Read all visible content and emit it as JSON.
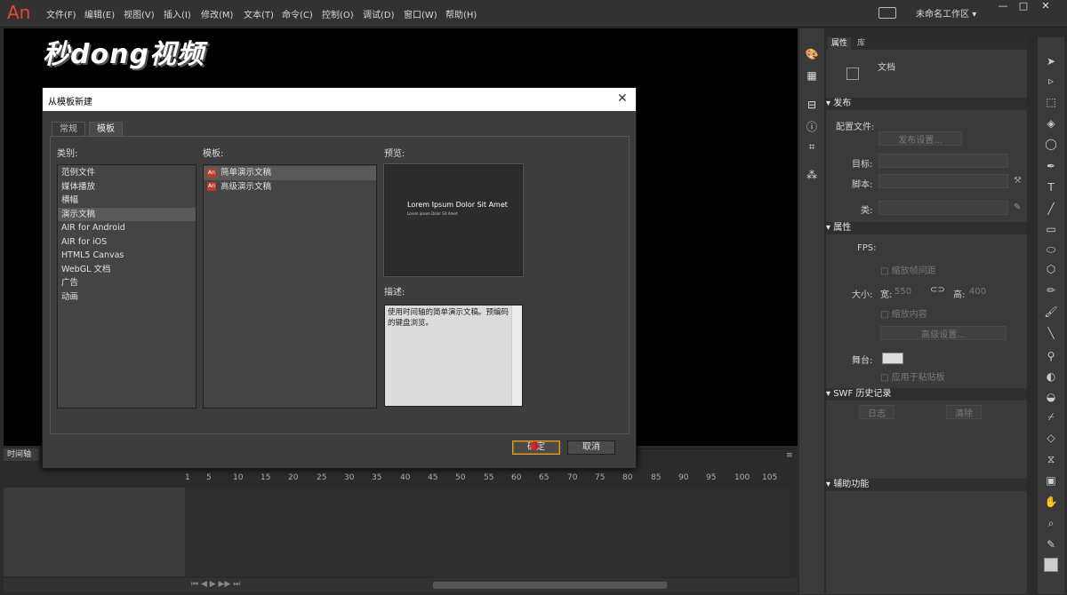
{
  "app": {
    "logo": "An",
    "workspace": "未命名工作区"
  },
  "menu": [
    "文件(F)",
    "编辑(E)",
    "视图(V)",
    "插入(I)",
    "修改(M)",
    "文本(T)",
    "命令(C)",
    "控制(O)",
    "调试(D)",
    "窗口(W)",
    "帮助(H)"
  ],
  "window_controls": {
    "minimize": "—",
    "maximize": "□",
    "close": "✕"
  },
  "watermark": "秒dong视频",
  "timeline": {
    "tab": "时间轴",
    "ruler": [
      "1",
      "5",
      "10",
      "15",
      "20",
      "25",
      "30",
      "35",
      "40",
      "45",
      "50",
      "55",
      "60",
      "65",
      "70",
      "75",
      "80",
      "85",
      "90",
      "95",
      "100",
      "105"
    ]
  },
  "properties": {
    "tabs": [
      "属性",
      "库"
    ],
    "doc_label": "文档",
    "publish": {
      "header": "发布",
      "profile_label": "配置文件:",
      "settings_button": "发布设置...",
      "target_label": "目标:",
      "script_label": "脚本:",
      "class_label": "类:"
    },
    "props": {
      "header": "属性",
      "fps_label": "FPS:",
      "size_label": "大小:",
      "width_label": "宽:",
      "width_value": "550",
      "height_label": "高:",
      "height_value": "400",
      "scale_label": "缩放帧间距",
      "scale_content": "缩放内容",
      "advanced": "高级设置...",
      "stage_label": "舞台:",
      "apply_paste": "应用于粘贴板"
    },
    "swf": {
      "header": "SWF 历史记录",
      "log": "日志",
      "clear": "清除"
    },
    "accessibility": {
      "header": "辅助功能"
    }
  },
  "dialog": {
    "title": "从模板新建",
    "close": "✕",
    "tabs": [
      "常规",
      "模板"
    ],
    "category_label": "类别:",
    "template_label": "模板:",
    "preview_label": "预览:",
    "description_label": "描述:",
    "categories": [
      "范例文件",
      "媒体播放",
      "横幅",
      "演示文稿",
      "AIR for Android",
      "AIR for iOS",
      "HTML5 Canvas",
      "WebGL 文档",
      "广告",
      "动画"
    ],
    "selected_category": "演示文稿",
    "templates": [
      "简单演示文稿",
      "高级演示文稿"
    ],
    "selected_template": "简单演示文稿",
    "preview_title": "Lorem Ipsum Dolor Sit Amet",
    "preview_sub": "Lorem ipsum Dolor Sit Amet",
    "description": "使用时间轴的简单演示文稿。预编码的键盘浏览。",
    "ok_button": "确定",
    "cancel_button": "取消"
  }
}
